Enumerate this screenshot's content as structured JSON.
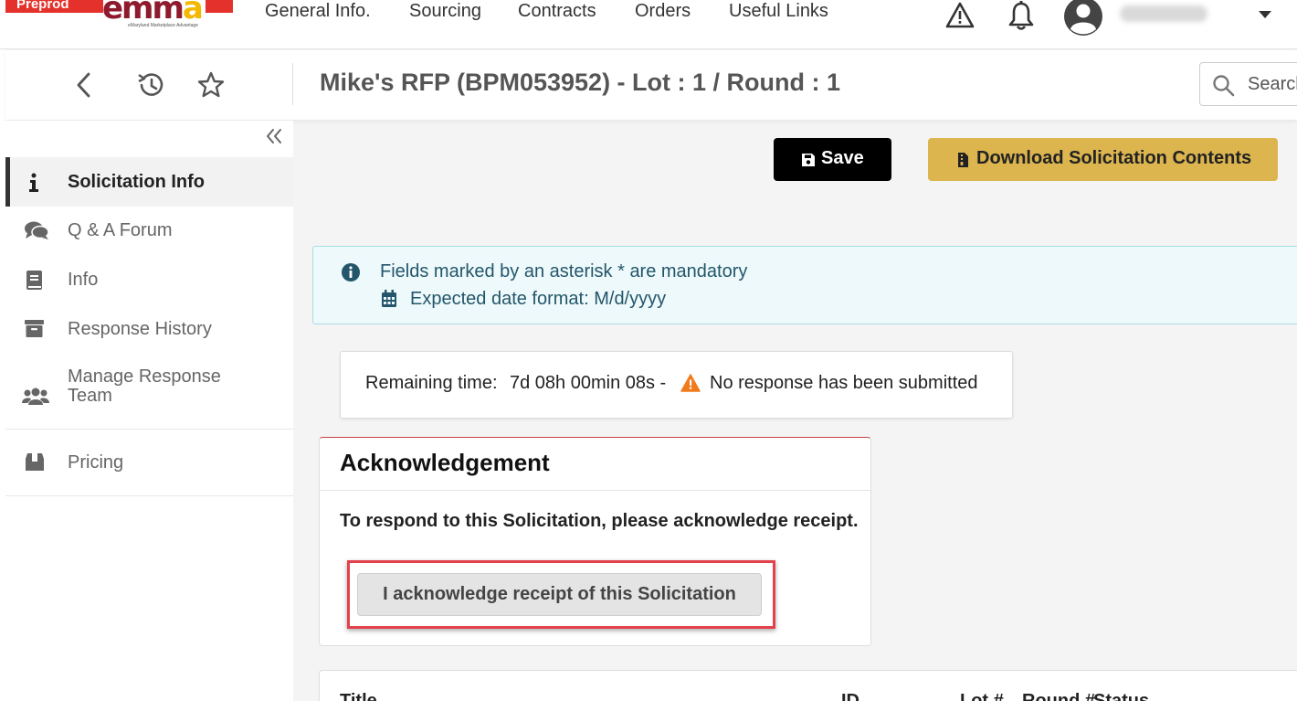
{
  "env_badge": "Preprod",
  "logo": {
    "text_main": "emm",
    "text_accent": "a",
    "tagline": "eMaryland Marketplace Advantage"
  },
  "nav": {
    "items": [
      {
        "label": "General Info."
      },
      {
        "label": "Sourcing"
      },
      {
        "label": "Contracts"
      },
      {
        "label": "Orders"
      },
      {
        "label": "Useful Links"
      }
    ],
    "icons": [
      "warning-icon",
      "bell-icon",
      "user-avatar-icon",
      "caret-down-icon"
    ]
  },
  "subheader": {
    "title": "Mike's RFP (BPM053952) - Lot : 1 / Round : 1",
    "icons": [
      "back-icon",
      "history-icon",
      "star-icon"
    ],
    "search_placeholder": "Search"
  },
  "sidebar": {
    "collapse_icon": "double-chevron-left-icon",
    "items": [
      {
        "label": "Solicitation Info",
        "icon": "info-icon",
        "active": true
      },
      {
        "label": "Q & A Forum",
        "icon": "comments-icon",
        "active": false
      },
      {
        "label": "Info",
        "icon": "book-icon",
        "active": false
      },
      {
        "label": "Response History",
        "icon": "archive-icon",
        "active": false
      },
      {
        "label": "Manage Response Team",
        "icon": "users-icon",
        "active": false
      },
      {
        "label": "Pricing",
        "icon": "box-icon",
        "active": false
      }
    ]
  },
  "actions": {
    "save_label": "Save",
    "download_label": "Download Solicitation Contents"
  },
  "info_box": {
    "line1": "Fields marked by an asterisk * are mandatory",
    "line2": "Expected date format: M/d/yyyy"
  },
  "remaining": {
    "label": "Remaining time:",
    "value": "7d 08h 00min 08s -",
    "status": "No response has been submitted"
  },
  "acknowledgement": {
    "title": "Acknowledgement",
    "body": "To respond to this Solicitation, please acknowledge receipt.",
    "button": "I acknowledge receipt of this Solicitation"
  },
  "table": {
    "headers": [
      "Title",
      "ID",
      "Lot #",
      "Round #",
      "Status"
    ]
  },
  "colors": {
    "accent_gold": "#dcb54f",
    "highlight_red": "#e3414b",
    "info_bg": "#eef9fb",
    "warning_orange": "#f07b1d"
  }
}
